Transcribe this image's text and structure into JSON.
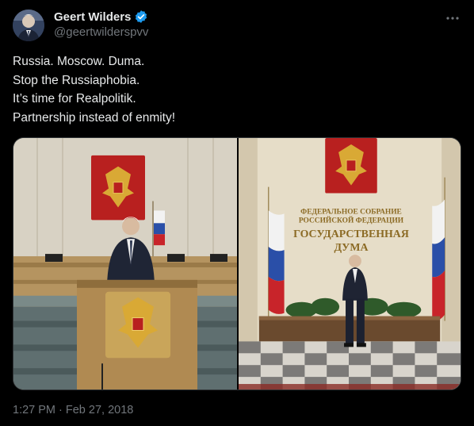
{
  "author": {
    "display_name": "Geert Wilders",
    "handle": "@geertwilderspvv",
    "verified": true,
    "avatar_icon": "profile-photo"
  },
  "tweet": {
    "lines": [
      "Russia. Moscow. Duma.",
      "Stop the Russiaphobia.",
      "It’s time for Realpolitik.",
      "Partnership instead of enmity!"
    ],
    "timestamp": "1:27 PM · Feb 27, 2018"
  },
  "media": {
    "photo_right_sign": [
      "ФЕДЕРАЛЬНОЕ СОБРАНИЕ",
      "РОССИЙСКОЙ ФЕДЕРАЦИИ",
      "ГОСУДАРСТВЕННАЯ",
      "ДУМА"
    ]
  },
  "colors": {
    "background": "#000000",
    "text": "#e7e9ea",
    "muted": "#71767b",
    "verified_blue": "#1d9bf0",
    "border": "#2f3336"
  },
  "icons": {
    "more": "more-horizontal-icon",
    "verified": "verified-badge-icon"
  }
}
